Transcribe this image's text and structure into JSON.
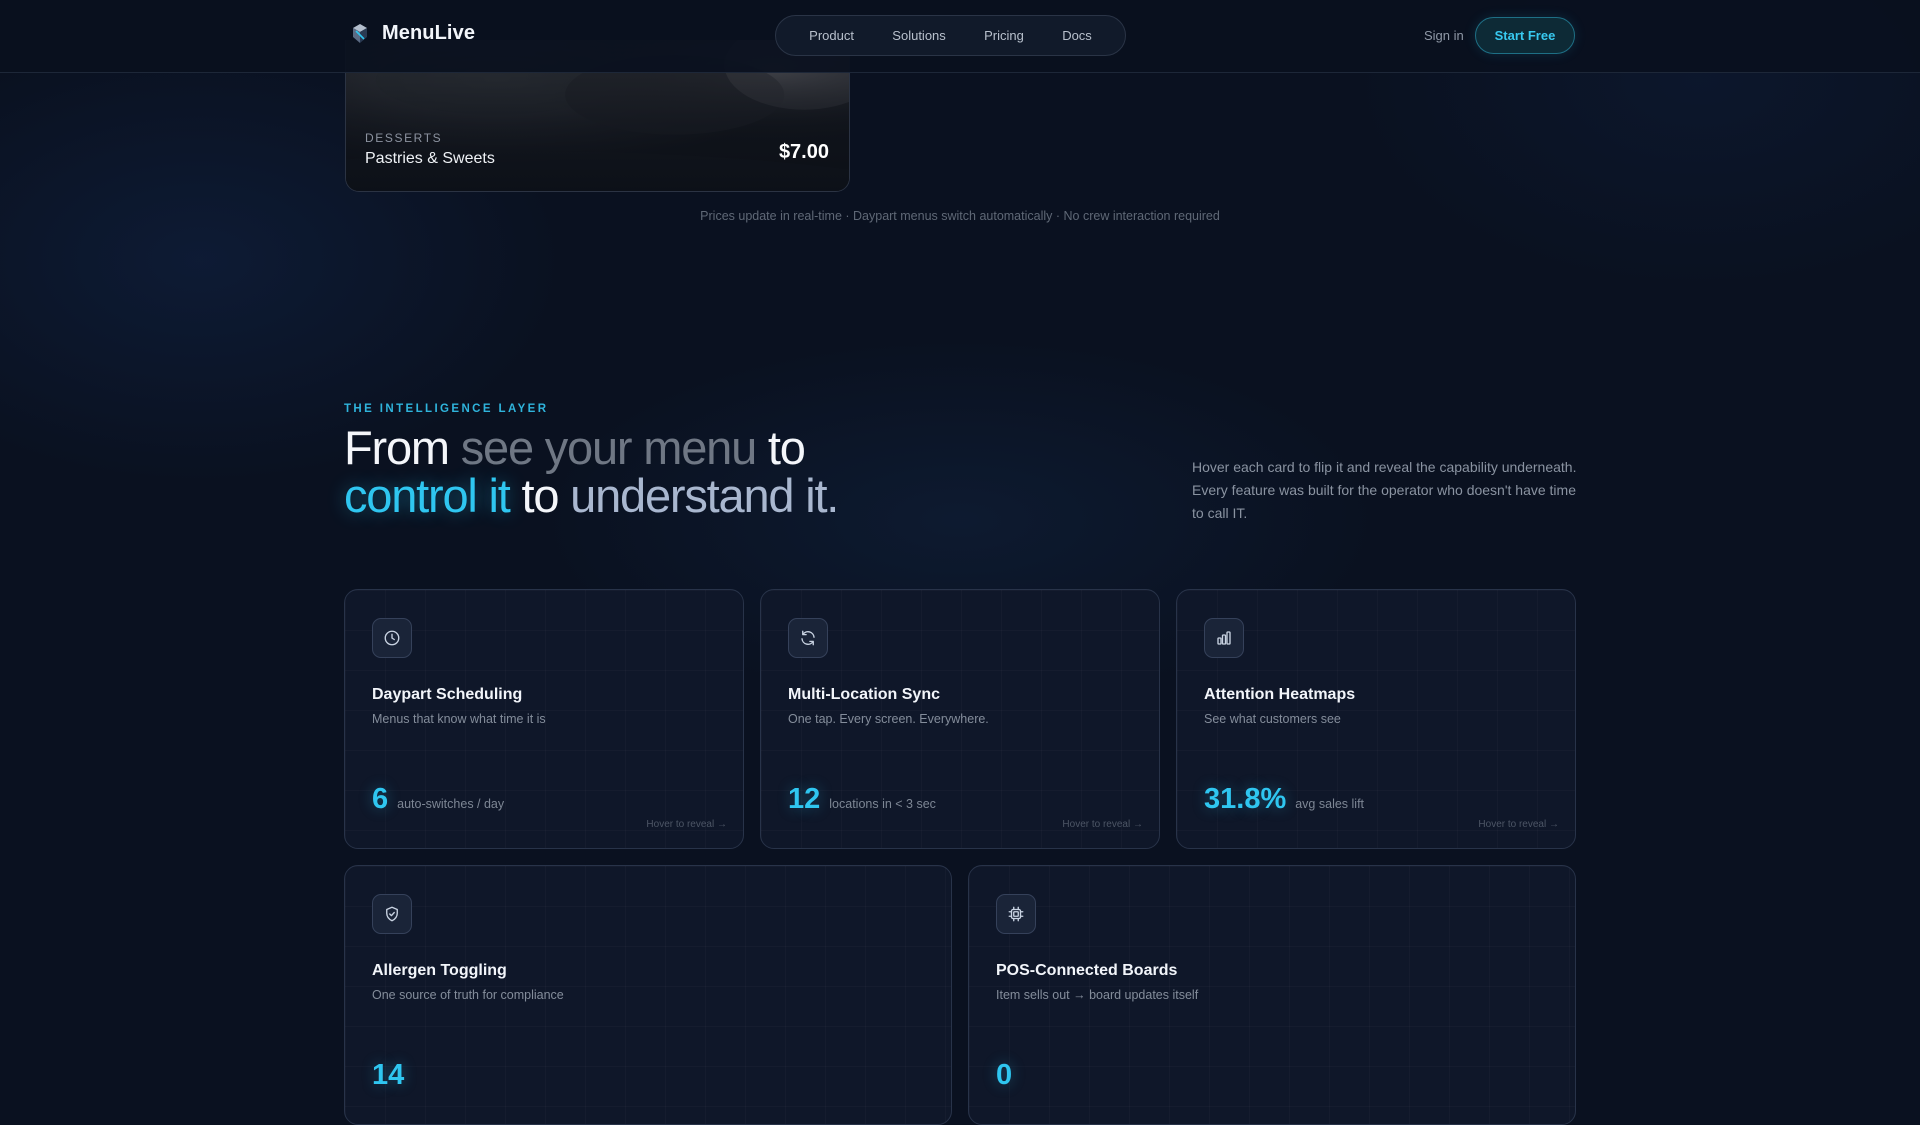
{
  "header": {
    "brand": "MenuLive",
    "nav": [
      "Product",
      "Solutions",
      "Pricing",
      "Docs"
    ],
    "sign_in": "Sign in",
    "cta": "Start Free"
  },
  "menu_card": {
    "category": "DESSERTS",
    "name": "Pastries & Sweets",
    "price": "$7.00"
  },
  "caption": "Prices update in real-time · Daypart menus switch automatically · No crew interaction required",
  "section": {
    "eyebrow": "THE INTELLIGENCE LAYER",
    "headline": {
      "p1": "From ",
      "p2": "see your menu",
      "p3": " to",
      "p4": "control it",
      "p5": " to ",
      "p6": "understand it."
    },
    "lede": "Hover each card to flip it and reveal the capability underneath. Every feature was built for the operator who doesn't have time to call IT."
  },
  "cards": [
    {
      "icon": "clock-icon",
      "title": "Daypart Scheduling",
      "subtitle": "Menus that know what time it is",
      "stat": "6",
      "stat_label": "auto-switches / day",
      "hint": "Hover to reveal →"
    },
    {
      "icon": "sync-icon",
      "title": "Multi-Location Sync",
      "subtitle": "One tap. Every screen. Everywhere.",
      "stat": "12",
      "stat_label": "locations in < 3 sec",
      "hint": "Hover to reveal →"
    },
    {
      "icon": "bar-chart-icon",
      "title": "Attention Heatmaps",
      "subtitle": "See what customers see",
      "stat": "31.8%",
      "stat_label": "avg sales lift",
      "hint": "Hover to reveal →"
    },
    {
      "icon": "shield-check-icon",
      "title": "Allergen Toggling",
      "subtitle": "One source of truth for compliance",
      "stat": "14",
      "stat_label": "",
      "hint": ""
    },
    {
      "icon": "chip-icon",
      "title": "POS-Connected Boards",
      "subtitle": "Item sells out → board updates itself",
      "stat": "0",
      "stat_label": "",
      "hint": ""
    }
  ],
  "colors": {
    "background": "#0a1120",
    "accent": "#2fc6f0",
    "card_border": "#283349"
  }
}
